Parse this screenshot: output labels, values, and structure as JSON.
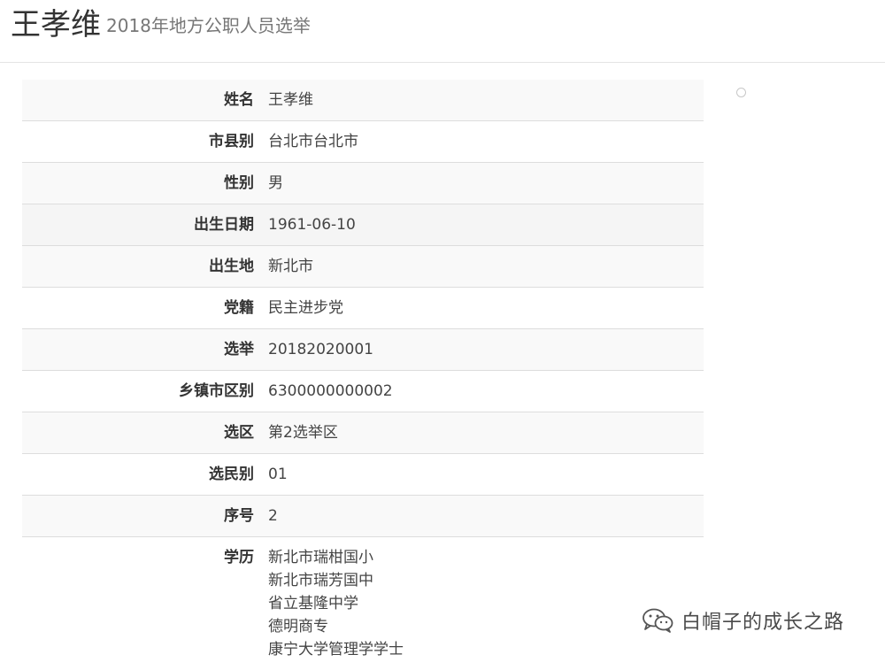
{
  "header": {
    "name": "王孝维",
    "subtitle": "2018年地方公职人员选举"
  },
  "profile": {
    "rows": [
      {
        "label": "姓名",
        "value": "王孝维"
      },
      {
        "label": "市县别",
        "value": "台北市台北市"
      },
      {
        "label": "性别",
        "value": "男"
      },
      {
        "label": "出生日期",
        "value": "1961-06-10"
      },
      {
        "label": "出生地",
        "value": "新北市"
      },
      {
        "label": "党籍",
        "value": "民主进步党"
      },
      {
        "label": "选举",
        "value": "20182020001"
      },
      {
        "label": "乡镇市区别",
        "value": "6300000000002"
      },
      {
        "label": "选区",
        "value": "第2选举区"
      },
      {
        "label": "选民别",
        "value": "01"
      },
      {
        "label": "序号",
        "value": "2"
      }
    ],
    "education": {
      "label": "学历",
      "lines": [
        "新北市瑞柑国小",
        "新北市瑞芳国中",
        "省立基隆中学",
        "德明商专",
        "康宁大学管理学学士"
      ]
    }
  },
  "watermark": {
    "icon": "wechat-icon",
    "text": "白帽子的成长之路"
  }
}
